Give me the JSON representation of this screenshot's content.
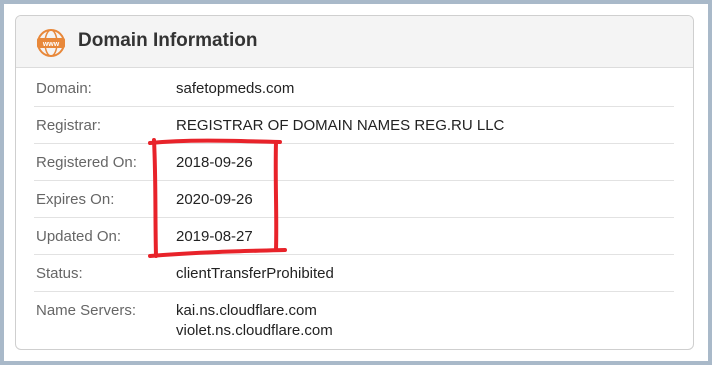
{
  "panel": {
    "title": "Domain Information",
    "icon": "www-globe-icon",
    "icon_text": "www",
    "accent_color": "#e8883a"
  },
  "rows": [
    {
      "label": "Domain:",
      "value": "safetopmeds.com"
    },
    {
      "label": "Registrar:",
      "value": "REGISTRAR OF DOMAIN NAMES REG.RU LLC"
    },
    {
      "label": "Registered On:",
      "value": "2018-09-26"
    },
    {
      "label": "Expires On:",
      "value": "2020-09-26"
    },
    {
      "label": "Updated On:",
      "value": "2019-08-27"
    },
    {
      "label": "Status:",
      "value": "clientTransferProhibited"
    },
    {
      "label": "Name Servers:",
      "values": [
        "kai.ns.cloudflare.com",
        "violet.ns.cloudflare.com"
      ]
    }
  ],
  "annotation": {
    "color": "#e8232a"
  }
}
